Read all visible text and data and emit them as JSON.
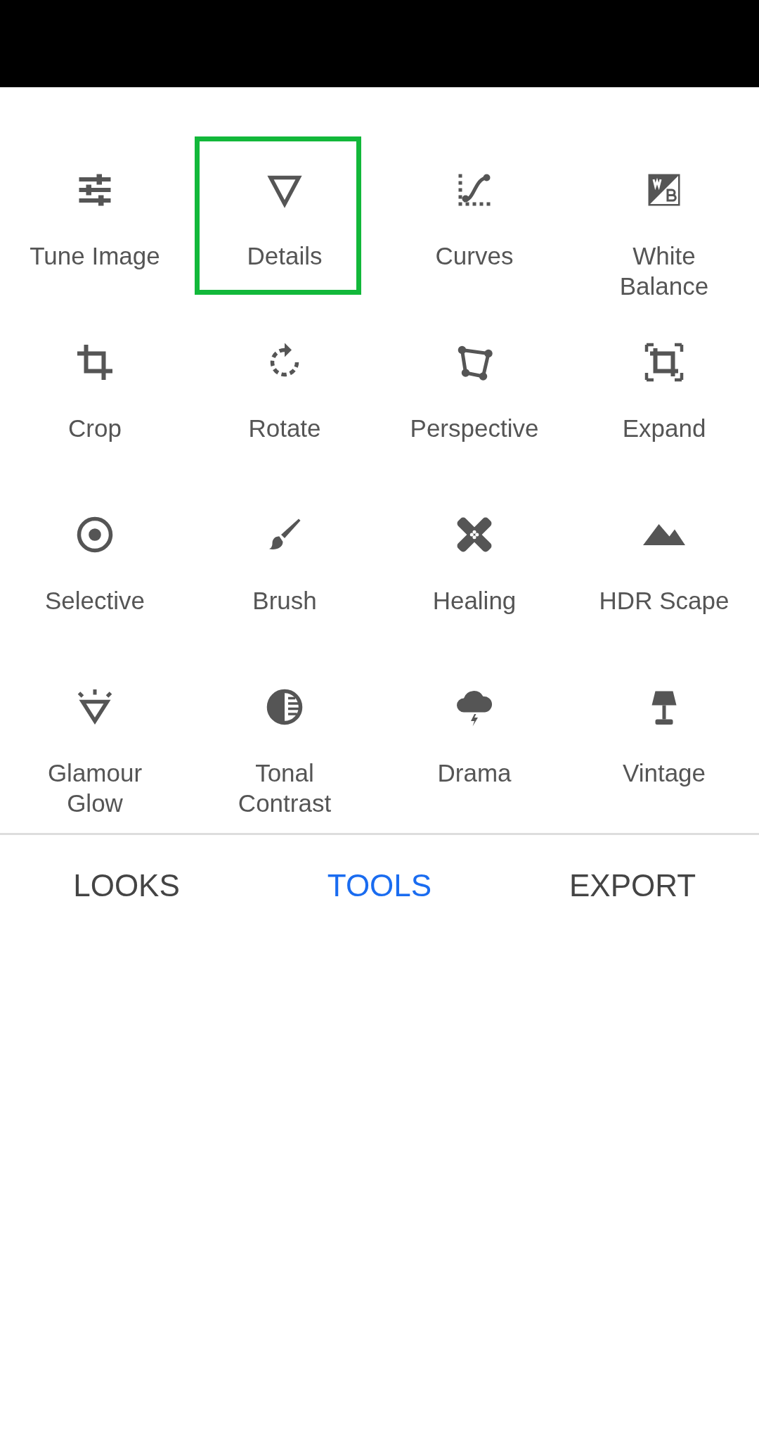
{
  "tools": [
    {
      "label": "Tune Image",
      "highlighted": false
    },
    {
      "label": "Details",
      "highlighted": true
    },
    {
      "label": "Curves",
      "highlighted": false
    },
    {
      "label": "White Balance",
      "highlighted": false
    },
    {
      "label": "Crop",
      "highlighted": false
    },
    {
      "label": "Rotate",
      "highlighted": false
    },
    {
      "label": "Perspective",
      "highlighted": false
    },
    {
      "label": "Expand",
      "highlighted": false
    },
    {
      "label": "Selective",
      "highlighted": false
    },
    {
      "label": "Brush",
      "highlighted": false
    },
    {
      "label": "Healing",
      "highlighted": false
    },
    {
      "label": "HDR Scape",
      "highlighted": false
    },
    {
      "label": "Glamour Glow",
      "highlighted": false
    },
    {
      "label": "Tonal Contrast",
      "highlighted": false
    },
    {
      "label": "Drama",
      "highlighted": false
    },
    {
      "label": "Vintage",
      "highlighted": false
    }
  ],
  "tabs": [
    {
      "label": "LOOKS",
      "selected": false
    },
    {
      "label": "TOOLS",
      "selected": true
    },
    {
      "label": "EXPORT",
      "selected": false
    }
  ]
}
